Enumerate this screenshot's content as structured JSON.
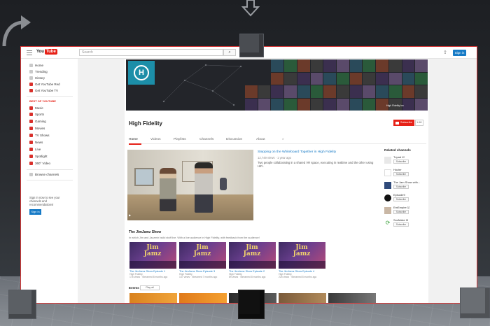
{
  "header": {
    "logo_text": "You",
    "logo_tube": "Tube",
    "search_placeholder": "Search",
    "search_icon": "search-icon",
    "upload_icon": "upload-icon",
    "signin_label": "Sign in"
  },
  "sidebar": {
    "items": [
      {
        "label": "Home",
        "icon": "home-icon"
      },
      {
        "label": "Trending",
        "icon": "trending-icon"
      },
      {
        "label": "History",
        "icon": "history-icon"
      },
      {
        "label": "Get YouTube Red",
        "icon": "youtube-red-icon"
      },
      {
        "label": "Get YouTube TV",
        "icon": "youtube-tv-icon"
      }
    ],
    "best_heading": "BEST OF YOUTUBE",
    "best_items": [
      {
        "label": "Music"
      },
      {
        "label": "Sports"
      },
      {
        "label": "Gaming"
      },
      {
        "label": "Movies"
      },
      {
        "label": "TV Shows"
      },
      {
        "label": "News"
      },
      {
        "label": "Live"
      },
      {
        "label": "Spotlight"
      },
      {
        "label": "360° Video"
      }
    ],
    "browse_label": "Browse channels",
    "signin_note": "Sign in now to see your channels and recommendations!",
    "signin_label": "Sign in"
  },
  "channel": {
    "banner_social": "High Fidelity Inc",
    "name": "High Fidelity",
    "subscribe_label": "Subscribe",
    "subscriber_count": "1.6K",
    "tabs": [
      {
        "label": "Home"
      },
      {
        "label": "Videos"
      },
      {
        "label": "Playlists"
      },
      {
        "label": "Channels"
      },
      {
        "label": "Discussion"
      },
      {
        "label": "About"
      }
    ]
  },
  "featured": {
    "title": "Stepping on the Whiteboard Together in High Fidelity",
    "meta": "12,749 views · 1 year ago",
    "description": "Two people collaborating in a shared VR space, executing in realtime and the other using HiFi."
  },
  "section": {
    "title": "The JimJamz Show",
    "subtitle": "In which Jim and Jazzmin build stuff live. With a live audience in High Fidelity, with feedback from the audience!",
    "videos": [
      {
        "thumb": "Jim Jamz",
        "title": "The JimJamz Show Episode 1",
        "channel": "High Fidelity",
        "meta": "176 views · Streamed 8 months ago"
      },
      {
        "thumb": "Jim Jamz",
        "title": "The JimJamz Show Episode 3",
        "channel": "High Fidelity",
        "meta": "147 views · Streamed 7 months ago"
      },
      {
        "thumb": "Jim Jamz",
        "title": "The JimJamz Show Episode 2",
        "channel": "High Fidelity",
        "meta": "89 views · Streamed 8 months ago"
      },
      {
        "thumb": "Jim Jamz",
        "title": "The JimJamz Show Episode 4",
        "channel": "High Fidelity",
        "meta": "225 views · Streamed 8 months ago"
      }
    ],
    "events_title": "Events",
    "events_badge": "Play all"
  },
  "related": {
    "heading": "Related channels",
    "channels": [
      {
        "name": "Tvpad ☑",
        "subscribe": "Subscribe"
      },
      {
        "name": "Hozier",
        "subscribe": "Subscribe"
      },
      {
        "name": "The Jam Show with...",
        "subscribe": "Subscribe"
      },
      {
        "name": "Episode9",
        "subscribe": "Subscribe"
      },
      {
        "name": "EmEmpire ☑",
        "subscribe": "Subscribe"
      },
      {
        "name": "SocMake ☑",
        "subscribe": "Subscribe"
      }
    ]
  },
  "colors": {
    "accent": "#e62117",
    "link": "#167ac6",
    "frame_border": "#d43a3a"
  }
}
